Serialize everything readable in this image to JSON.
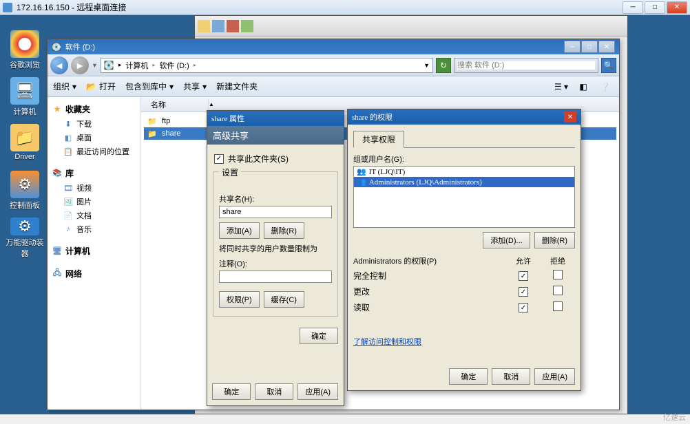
{
  "rdp": {
    "title": "172.16.16.150 - 远程桌面连接"
  },
  "desktop_icons": [
    {
      "label": "谷歌浏览",
      "color": "#fff",
      "emoji": "◯"
    },
    {
      "label": "计算机",
      "color": "#6ab0e8",
      "emoji": "🖥"
    },
    {
      "label": "Driver",
      "color": "#f7c96a",
      "emoji": "📁"
    },
    {
      "label": "控制面板",
      "color": "#5090d8",
      "emoji": "⚙"
    },
    {
      "label": "万能驱动装器",
      "color": "#3080d0",
      "emoji": "⚙"
    }
  ],
  "explorer": {
    "title": "软件 (D:)",
    "breadcrumb": [
      "计算机",
      "软件 (D:)"
    ],
    "search_placeholder": "搜索 软件 (D:)",
    "cmd": {
      "organize": "组织",
      "open": "打开",
      "include": "包含到库中",
      "share": "共享",
      "newfolder": "新建文件夹"
    },
    "sidebar": {
      "fav": {
        "label": "收藏夹",
        "items": [
          "下载",
          "桌面",
          "最近访问的位置"
        ]
      },
      "lib": {
        "label": "库",
        "items": [
          "视频",
          "图片",
          "文档",
          "音乐"
        ]
      },
      "computer": {
        "label": "计算机"
      },
      "network": {
        "label": "网络"
      }
    },
    "list": {
      "header": "名称",
      "items": [
        {
          "name": "ftp",
          "sel": false
        },
        {
          "name": "share",
          "sel": true
        }
      ]
    }
  },
  "props": {
    "title": "share 属性",
    "adv_title": "高级共享",
    "share_chk": "共享此文件夹(S)",
    "settings": "设置",
    "sharename_lbl": "共享名(H):",
    "sharename": "share",
    "add": "添加(A)",
    "remove": "删除(R)",
    "limit_text": "将同时共享的用户数量限制为",
    "comment_lbl": "注释(O):",
    "perm_btn": "权限(P)",
    "cache_btn": "缓存(C)",
    "ok": "确定",
    "cancel": "取消",
    "apply": "应用(A)",
    "ok2": "确定"
  },
  "perm": {
    "title": "share 的权限",
    "tab": "共享权限",
    "groups_lbl": "组或用户名(G):",
    "groups": [
      {
        "name": "IT (LJQ\\IT)",
        "sel": false
      },
      {
        "name": "Administrators (LJQ\\Administrators)",
        "sel": true
      }
    ],
    "add": "添加(D)...",
    "remove": "删除(R)",
    "perm_lbl": "Administrators 的权限(P)",
    "allow": "允许",
    "deny": "拒绝",
    "rows": [
      {
        "name": "完全控制",
        "allow": true,
        "deny": false
      },
      {
        "name": "更改",
        "allow": true,
        "deny": false
      },
      {
        "name": "读取",
        "allow": true,
        "deny": false
      }
    ],
    "link": "了解访问控制和权限",
    "ok": "确定",
    "cancel": "取消",
    "apply": "应用(A)"
  },
  "watermark": "亿速云"
}
